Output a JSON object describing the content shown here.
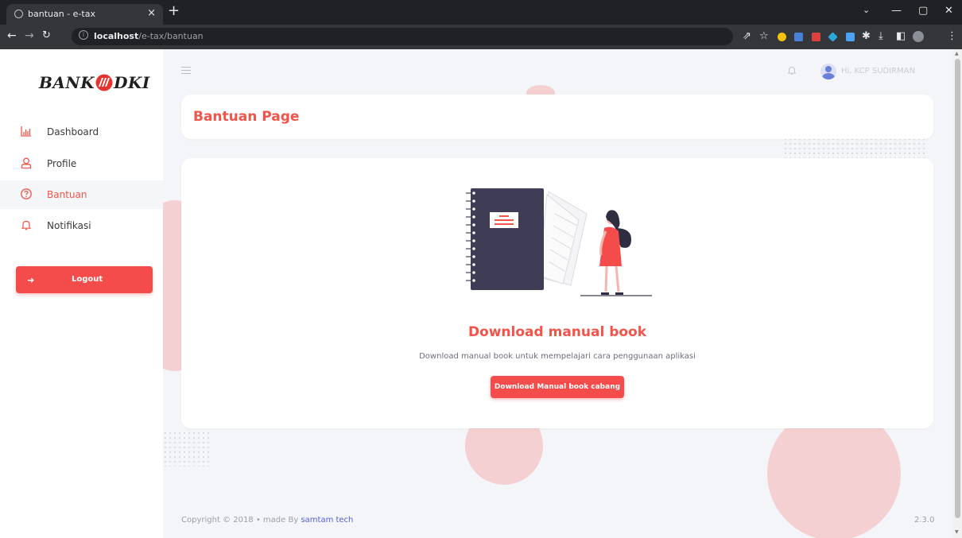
{
  "browser": {
    "tab_title": "bantuan - e-tax",
    "tab_close": "×",
    "new_tab": "+",
    "url_host": "localhost",
    "url_path": "/e-tax/bantuan",
    "url_info": "i"
  },
  "sidebar": {
    "logo_left": "BANK",
    "logo_right": "DKI",
    "items": [
      {
        "label": "Dashboard",
        "icon": "bar-chart-icon"
      },
      {
        "label": "Profile",
        "icon": "user-icon"
      },
      {
        "label": "Bantuan",
        "icon": "help-circle-icon",
        "active": true
      },
      {
        "label": "Notifikasi",
        "icon": "bell-icon"
      }
    ],
    "logout_label": "Logout"
  },
  "header": {
    "user_greeting": "Hi, KCP SUDIRMAN"
  },
  "page": {
    "title": "Bantuan Page",
    "download_title": "Download manual book",
    "download_desc": "Download manual book untuk mempelajari cara penggunaan aplikasi",
    "download_button": "Download Manual book cabang"
  },
  "footer": {
    "copyright": "Copyright © 2018  •  made By ",
    "maker": "samtam tech",
    "version": "2.3.0"
  },
  "colors": {
    "accent": "#f2544a",
    "button": "#f44b4b",
    "background": "#f4f5f8"
  }
}
